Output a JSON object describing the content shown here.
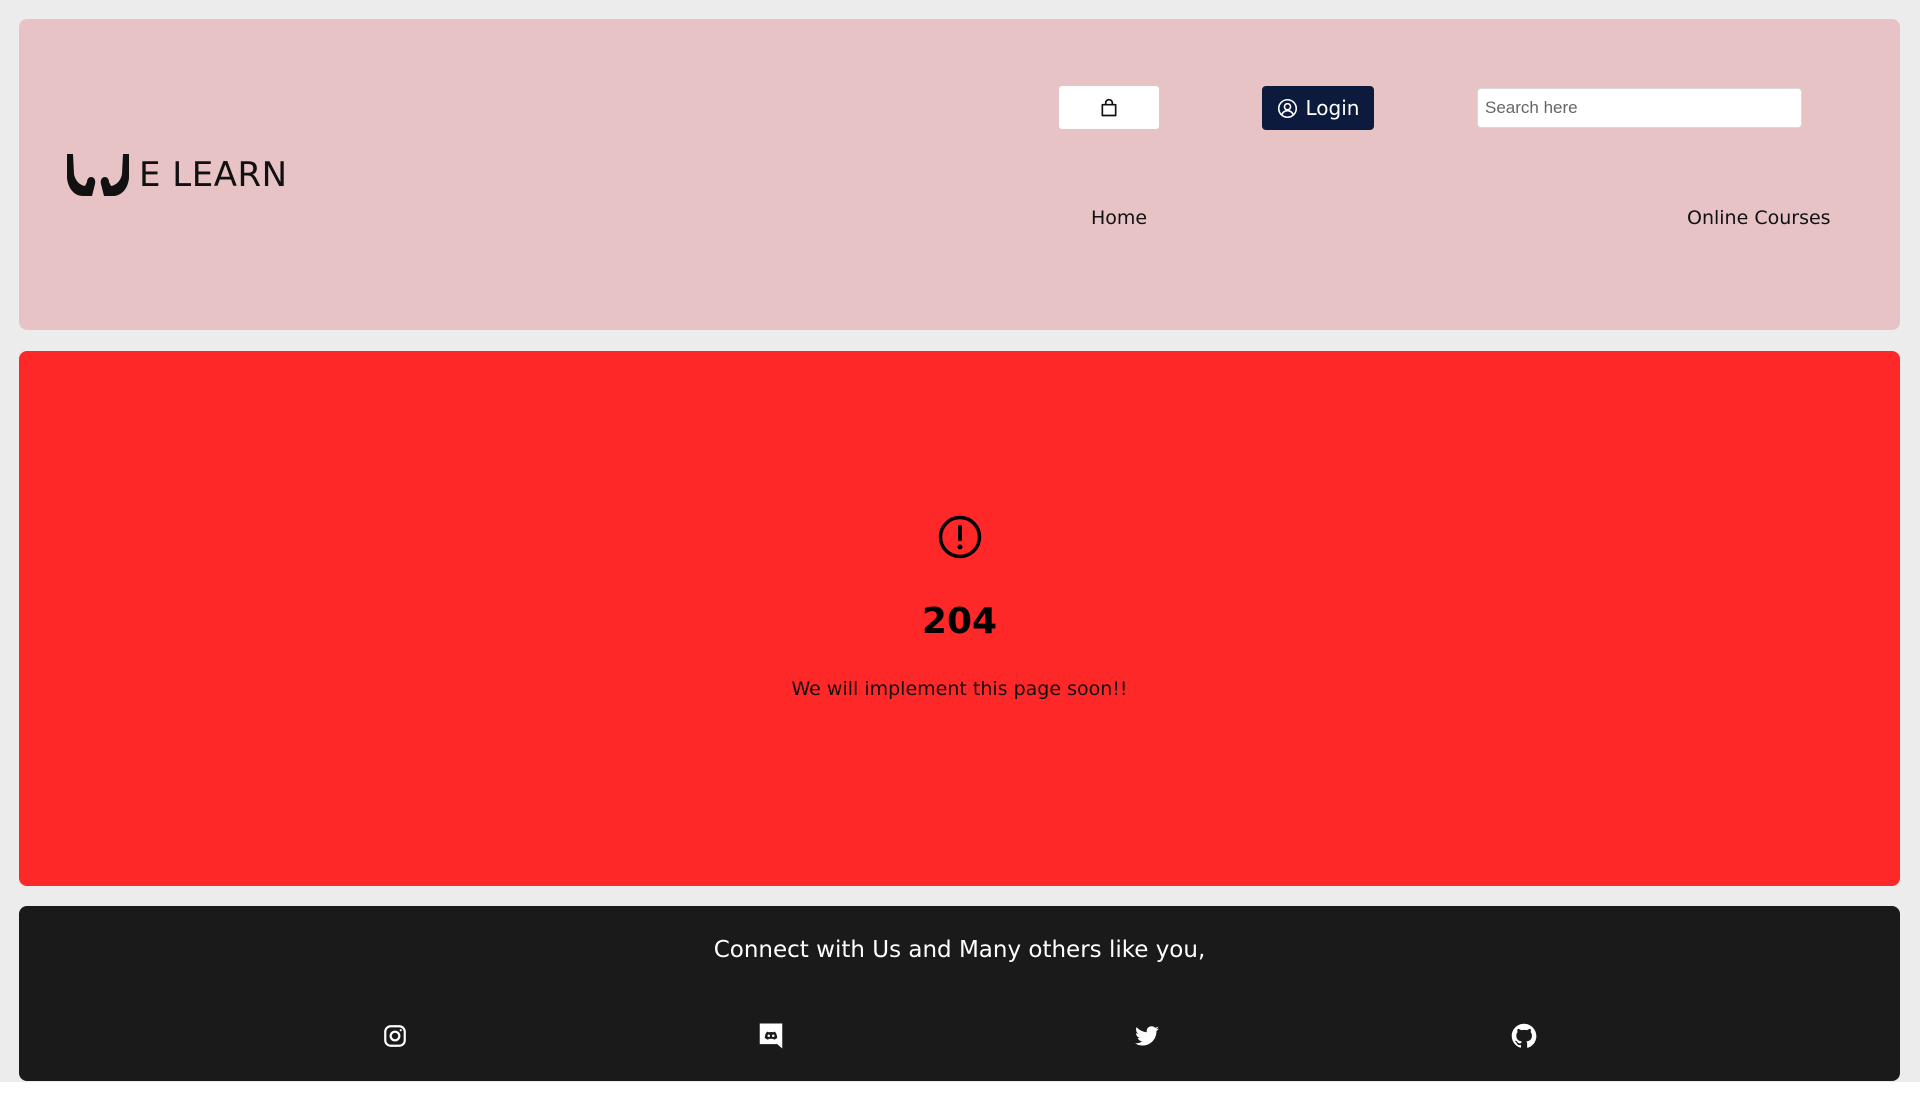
{
  "brand": {
    "name": "E LEARN",
    "logo_icon": "hands-icon"
  },
  "header": {
    "cart_icon": "shopping-bag-icon",
    "login_label": "Login",
    "login_icon": "user-circle-icon",
    "search_placeholder": "Search here",
    "search_value": "",
    "nav": {
      "home": "Home",
      "courses": "Online Courses"
    }
  },
  "main": {
    "icon": "alert-circle-icon",
    "code": "204",
    "message": "We will implement this page soon!!"
  },
  "footer": {
    "heading": "Connect with Us and Many others like you,",
    "socials": [
      "instagram-icon",
      "discord-icon",
      "twitter-icon",
      "github-icon"
    ]
  },
  "colors": {
    "header_bg": "#e7c3c6",
    "login_bg": "#0b1a3d",
    "main_bg": "#ff2828",
    "footer_bg": "#1a1a1a",
    "page_bg": "#ececec"
  }
}
